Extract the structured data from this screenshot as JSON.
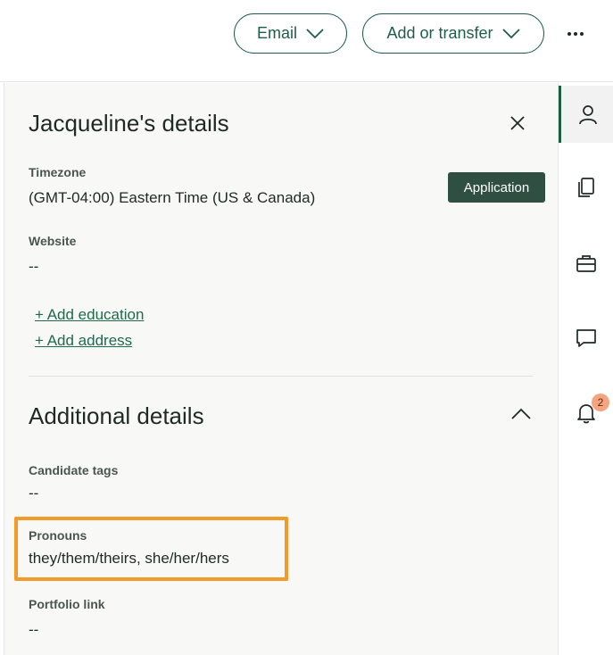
{
  "header": {
    "email_label": "Email",
    "transfer_label": "Add or transfer"
  },
  "details": {
    "title": "Jacqueline's details",
    "timezone_label": "Timezone",
    "timezone_value": "(GMT-04:00) Eastern Time (US & Canada)",
    "application_badge": "Application",
    "website_label": "Website",
    "website_value": "--",
    "add_education": "+ Add education",
    "add_address": "+ Add address"
  },
  "additional": {
    "title": "Additional details",
    "tags_label": "Candidate tags",
    "tags_value": "--",
    "pronouns_label": "Pronouns",
    "pronouns_value": "they/them/theirs, she/her/hers",
    "portfolio_label": "Portfolio link",
    "portfolio_value": "--"
  },
  "rail": {
    "items": [
      {
        "icon": "person-icon",
        "active": true
      },
      {
        "icon": "documents-icon",
        "active": false
      },
      {
        "icon": "briefcase-icon",
        "active": false
      },
      {
        "icon": "chat-icon",
        "active": false
      },
      {
        "icon": "bell-icon",
        "active": false
      }
    ],
    "notification_count": "2"
  },
  "colors": {
    "accent": "#1e5e45",
    "badge_bg": "#2e4f42",
    "highlight": "#f39a2a",
    "notification": "#f4a47e"
  }
}
